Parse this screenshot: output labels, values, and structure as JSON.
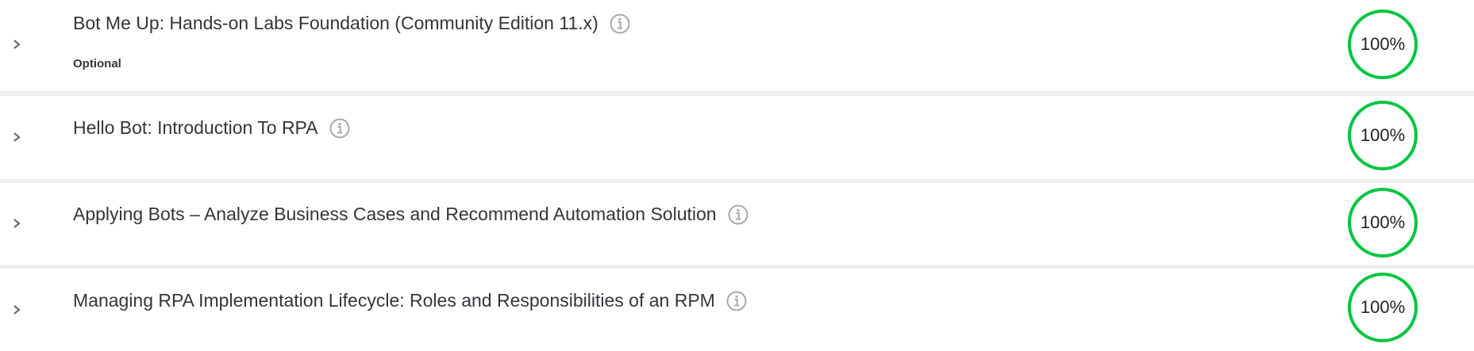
{
  "accent_color": "#00c63f",
  "courses": [
    {
      "title": "Bot Me Up: Hands-on Labs Foundation (Community Edition 11.x)",
      "tag": "Optional",
      "progress_label": "100%",
      "progress": 100
    },
    {
      "title": "Hello Bot: Introduction To RPA",
      "progress_label": "100%",
      "progress": 100
    },
    {
      "title": "Applying Bots – Analyze Business Cases and Recommend Automation Solution",
      "progress_label": "100%",
      "progress": 100
    },
    {
      "title": "Managing RPA Implementation Lifecycle: Roles and Responsibilities of an RPM",
      "progress_label": "100%",
      "progress": 100
    }
  ]
}
